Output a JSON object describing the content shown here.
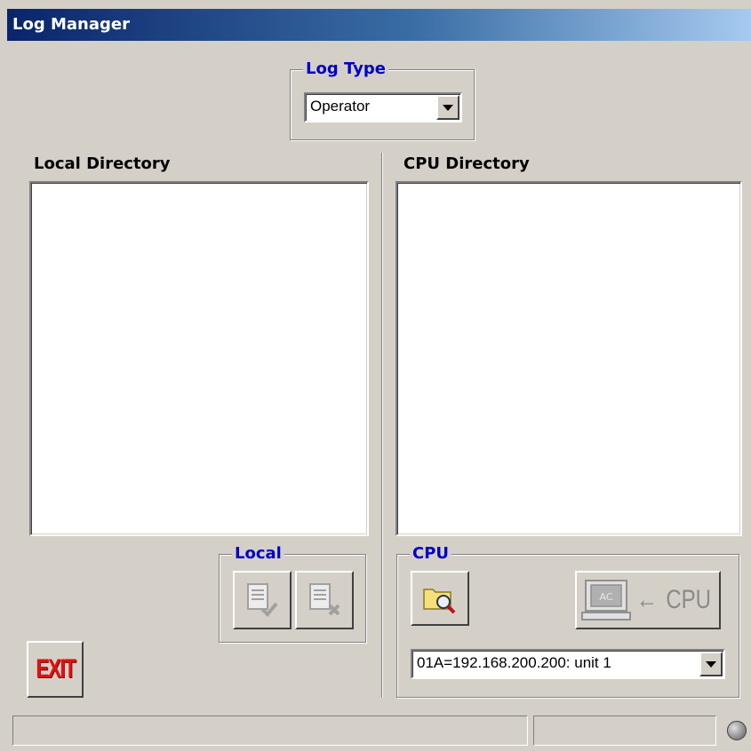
{
  "window": {
    "title": "Log Manager"
  },
  "log_type": {
    "legend": "Log Type",
    "selected": "Operator"
  },
  "local_directory": {
    "label": "Local Directory",
    "items": []
  },
  "cpu_directory": {
    "label": "CPU Directory",
    "items": []
  },
  "local_group": {
    "legend": "Local",
    "buttons": [
      "upload-file-icon",
      "delete-file-icon"
    ]
  },
  "cpu_group": {
    "legend": "CPU",
    "browse_icon": "folder-search-icon",
    "transfer_label": "CPU",
    "transfer_icon_text": "AC",
    "selected_cpu": "01A=192.168.200.200: unit 1"
  },
  "exit_button": {
    "label": "EXIT",
    "color": "#e01010"
  },
  "status_bar": {
    "left_text": "",
    "right_text": "",
    "indicator": "gray"
  },
  "colors": {
    "legend": "#0000c8",
    "titlebar_start": "#0a246a",
    "titlebar_end": "#a6caf0",
    "face": "#d4d0c8"
  }
}
